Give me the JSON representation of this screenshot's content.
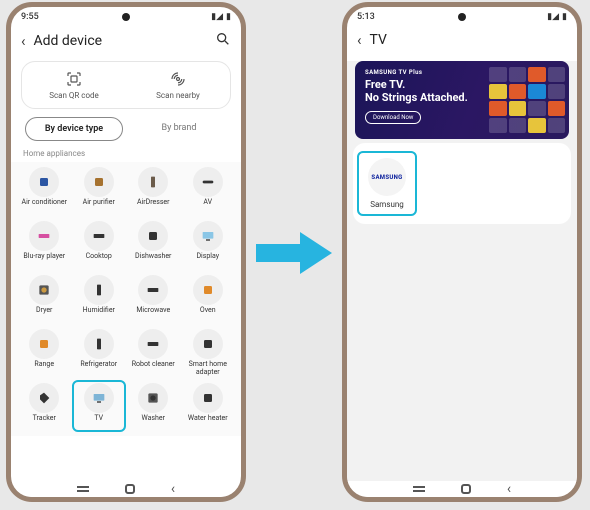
{
  "left": {
    "status_time": "9:55",
    "title": "Add device",
    "scan_qr": "Scan QR code",
    "scan_nearby": "Scan nearby",
    "tab_type": "By device type",
    "tab_brand": "By brand",
    "section": "Home appliances",
    "devices": [
      {
        "name": "air-conditioner",
        "label": "Air conditioner",
        "color": "#2b55a2",
        "shape": "rect"
      },
      {
        "name": "air-purifier",
        "label": "Air purifier",
        "color": "#a6722f",
        "shape": "rect"
      },
      {
        "name": "airdresser",
        "label": "AirDresser",
        "color": "#6b5b4a",
        "shape": "tall"
      },
      {
        "name": "av",
        "label": "AV",
        "color": "#333",
        "shape": "bar"
      },
      {
        "name": "bluray-player",
        "label": "Blu-ray player",
        "color": "#d64fa1",
        "shape": "flat"
      },
      {
        "name": "cooktop",
        "label": "Cooktop",
        "color": "#333",
        "shape": "flat"
      },
      {
        "name": "dishwasher",
        "label": "Dishwasher",
        "color": "#333",
        "shape": "rect"
      },
      {
        "name": "display",
        "label": "Display",
        "color": "#8ac6e6",
        "shape": "screen"
      },
      {
        "name": "dryer",
        "label": "Dryer",
        "color": "#cc9a42",
        "shape": "circle"
      },
      {
        "name": "humidifier",
        "label": "Humidifier",
        "color": "#333",
        "shape": "tall"
      },
      {
        "name": "microwave",
        "label": "Microwave",
        "color": "#333",
        "shape": "flat"
      },
      {
        "name": "oven",
        "label": "Oven",
        "color": "#e08a2a",
        "shape": "rect"
      },
      {
        "name": "range",
        "label": "Range",
        "color": "#e08a2a",
        "shape": "rect"
      },
      {
        "name": "refrigerator",
        "label": "Refrigerator",
        "color": "#333",
        "shape": "tall"
      },
      {
        "name": "robot-cleaner",
        "label": "Robot cleaner",
        "color": "#333",
        "shape": "flat"
      },
      {
        "name": "smart-home-adapter",
        "label": "Smart home adapter",
        "color": "#333",
        "shape": "rect"
      },
      {
        "name": "tracker",
        "label": "Tracker",
        "color": "#333",
        "shape": "tag"
      },
      {
        "name": "tv",
        "label": "TV",
        "color": "#7db4d6",
        "shape": "screen",
        "highlighted": true
      },
      {
        "name": "washer",
        "label": "Washer",
        "color": "#333",
        "shape": "circle"
      },
      {
        "name": "water-heater",
        "label": "Water heater",
        "color": "#333",
        "shape": "rect"
      }
    ]
  },
  "right": {
    "status_time": "5:13",
    "title": "TV",
    "banner_tag": "SAMSUNG TV Plus",
    "banner_line1": "Free TV.",
    "banner_line2": "No Strings Attached.",
    "banner_cta": "Download Now",
    "brand_logo_text": "SAMSUNG",
    "brand_label": "Samsung"
  },
  "colors": {
    "highlight": "#1ab7d6",
    "arrow": "#27b4e0"
  }
}
